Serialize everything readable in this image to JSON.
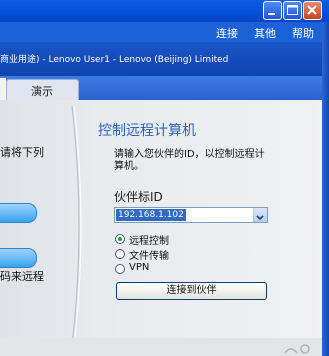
{
  "menu": {
    "connect": "连接",
    "other": "其他",
    "help": "帮助"
  },
  "license_text": "商业用途) - Lenovo User1 - Lenovo (Beijing) Limited",
  "tabs": {
    "demo": "演示"
  },
  "left_panel": {
    "line1": "请将下列",
    "line2": "码来远程"
  },
  "right_panel": {
    "heading": "控制远程计算机",
    "desc_line1": "请输入您伙伴的ID，以控制远程计",
    "desc_line2": "算机。",
    "id_label": "伙伴标ID",
    "id_value": "192.168.1.102",
    "radio_options": [
      "远程控制",
      "文件传输",
      "VPN"
    ],
    "selected_option": "远程控制",
    "connect_button": "连接到伙伴"
  },
  "colors": {
    "heading": "#2b62c4",
    "titlebar": "#0545c8"
  }
}
